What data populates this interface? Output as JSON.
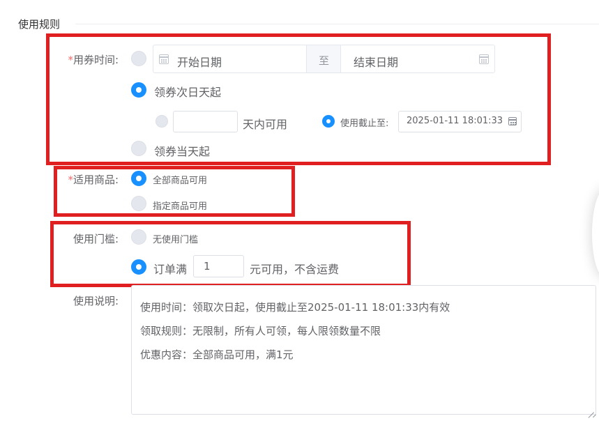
{
  "section": {
    "title": "使用规则"
  },
  "validity": {
    "label": "用券时间:",
    "required_mark": "*",
    "start_placeholder": "开始日期",
    "separator": "至",
    "end_placeholder": "结束日期",
    "option_next_day": "领券次日天起",
    "days_value": "",
    "days_suffix": "天内可用",
    "deadline_label": "使用截止至:",
    "deadline_value": "2025-01-11 18:01:33",
    "option_same_day": "领券当天起",
    "selected": "领券次日天起"
  },
  "products": {
    "label": "适用商品:",
    "required_mark": "*",
    "option_all": "全部商品可用",
    "option_specific": "指定商品可用",
    "selected": "全部商品可用"
  },
  "threshold": {
    "label": "使用门槛:",
    "option_none": "无使用门槛",
    "option_order_prefix": "订单满",
    "order_amount": "1",
    "option_order_suffix": "元可用，不含运费",
    "selected": "订单满"
  },
  "description": {
    "label": "使用说明:",
    "lines": [
      "使用时间：领取次日起，使用截止至2025-01-11 18:01:33内有效",
      "领取规则：无限制，所有人可领，每人限领数量不限",
      "优惠内容：全部商品可用，满1元"
    ]
  },
  "colors": {
    "accent": "#1890ff",
    "highlight_box": "#e02020",
    "required": "#f56c6c"
  }
}
